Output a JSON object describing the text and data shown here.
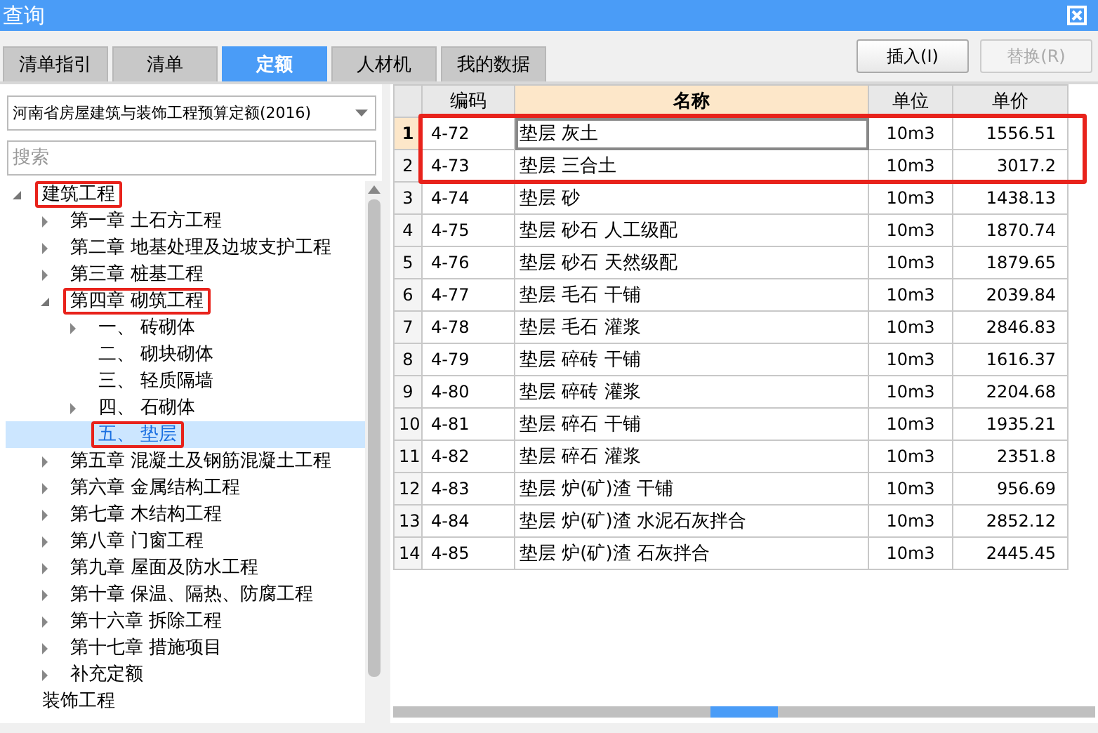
{
  "window": {
    "title": "查询"
  },
  "tabs": [
    {
      "label": "清单指引",
      "selected": false
    },
    {
      "label": "清单",
      "selected": false
    },
    {
      "label": "定额",
      "selected": true
    },
    {
      "label": "人材机",
      "selected": false
    },
    {
      "label": "我的数据",
      "selected": false
    }
  ],
  "buttons": [
    {
      "label": "插入(I)",
      "disabled": false
    },
    {
      "label": "替换(R)",
      "disabled": true
    }
  ],
  "library_select": {
    "value": "河南省房屋建筑与装饰工程预算定额(2016)"
  },
  "search": {
    "placeholder": "搜索"
  },
  "tree": [
    {
      "label": "建筑工程",
      "expanded": true,
      "marked": true,
      "selected": false,
      "children": [
        {
          "label": "第一章  土石方工程",
          "expanded": false,
          "marked": false,
          "selected": false
        },
        {
          "label": "第二章  地基处理及边坡支护工程",
          "expanded": false,
          "marked": false,
          "selected": false
        },
        {
          "label": "第三章  桩基工程",
          "expanded": false,
          "marked": false,
          "selected": false
        },
        {
          "label": "第四章  砌筑工程",
          "expanded": true,
          "marked": true,
          "selected": false,
          "children": [
            {
              "label": "一、  砖砌体",
              "expanded": false,
              "marked": false,
              "selected": false
            },
            {
              "label": "二、  砌块砌体",
              "marked": false,
              "selected": false
            },
            {
              "label": "三、  轻质隔墙",
              "marked": false,
              "selected": false
            },
            {
              "label": "四、  石砌体",
              "expanded": false,
              "marked": false,
              "selected": false
            },
            {
              "label": "五、  垫层",
              "marked": true,
              "selected": true
            }
          ]
        },
        {
          "label": "第五章  混凝土及钢筋混凝土工程",
          "expanded": false,
          "marked": false,
          "selected": false
        },
        {
          "label": "第六章  金属结构工程",
          "expanded": false,
          "marked": false,
          "selected": false
        },
        {
          "label": "第七章  木结构工程",
          "expanded": false,
          "marked": false,
          "selected": false
        },
        {
          "label": "第八章  门窗工程",
          "expanded": false,
          "marked": false,
          "selected": false
        },
        {
          "label": "第九章  屋面及防水工程",
          "expanded": false,
          "marked": false,
          "selected": false
        },
        {
          "label": "第十章  保温、隔热、防腐工程",
          "expanded": false,
          "marked": false,
          "selected": false
        },
        {
          "label": "第十六章  拆除工程",
          "expanded": false,
          "marked": false,
          "selected": false
        },
        {
          "label": "第十七章  措施项目",
          "expanded": false,
          "marked": false,
          "selected": false
        },
        {
          "label": "补充定额",
          "expanded": false,
          "marked": false,
          "selected": false
        }
      ]
    },
    {
      "label": "装饰工程",
      "marked": false,
      "selected": false
    }
  ],
  "table": {
    "columns": [
      {
        "label": "编码",
        "sorted": false
      },
      {
        "label": "名称",
        "sorted": true
      },
      {
        "label": "单位",
        "sorted": false
      },
      {
        "label": "单价",
        "sorted": false
      }
    ],
    "marked_box": true,
    "rows": [
      {
        "index": "1",
        "code": "4-72",
        "name": "垫层  灰土",
        "unit": "10m3",
        "price": "1556.51",
        "selected": true
      },
      {
        "index": "2",
        "code": "4-73",
        "name": "垫层  三合土",
        "unit": "10m3",
        "price": "3017.2",
        "selected": false
      },
      {
        "index": "3",
        "code": "4-74",
        "name": "垫层  砂",
        "unit": "10m3",
        "price": "1438.13",
        "selected": false
      },
      {
        "index": "4",
        "code": "4-75",
        "name": "垫层  砂石  人工级配",
        "unit": "10m3",
        "price": "1870.74",
        "selected": false
      },
      {
        "index": "5",
        "code": "4-76",
        "name": "垫层  砂石  天然级配",
        "unit": "10m3",
        "price": "1879.65",
        "selected": false
      },
      {
        "index": "6",
        "code": "4-77",
        "name": "垫层  毛石  干铺",
        "unit": "10m3",
        "price": "2039.84",
        "selected": false
      },
      {
        "index": "7",
        "code": "4-78",
        "name": "垫层  毛石  灌浆",
        "unit": "10m3",
        "price": "2846.83",
        "selected": false
      },
      {
        "index": "8",
        "code": "4-79",
        "name": "垫层  碎砖  干铺",
        "unit": "10m3",
        "price": "1616.37",
        "selected": false
      },
      {
        "index": "9",
        "code": "4-80",
        "name": "垫层  碎砖  灌浆",
        "unit": "10m3",
        "price": "2204.68",
        "selected": false
      },
      {
        "index": "10",
        "code": "4-81",
        "name": "垫层  碎石  干铺",
        "unit": "10m3",
        "price": "1935.21",
        "selected": false
      },
      {
        "index": "11",
        "code": "4-82",
        "name": "垫层  碎石  灌浆",
        "unit": "10m3",
        "price": "2351.8",
        "selected": false
      },
      {
        "index": "12",
        "code": "4-83",
        "name": "垫层  炉(矿)渣  干铺",
        "unit": "10m3",
        "price": "956.69",
        "selected": false
      },
      {
        "index": "13",
        "code": "4-84",
        "name": "垫层  炉(矿)渣  水泥石灰拌合",
        "unit": "10m3",
        "price": "2852.12",
        "selected": false
      },
      {
        "index": "14",
        "code": "4-85",
        "name": "垫层  炉(矿)渣  石灰拌合",
        "unit": "10m3",
        "price": "2445.45",
        "selected": false
      }
    ]
  }
}
